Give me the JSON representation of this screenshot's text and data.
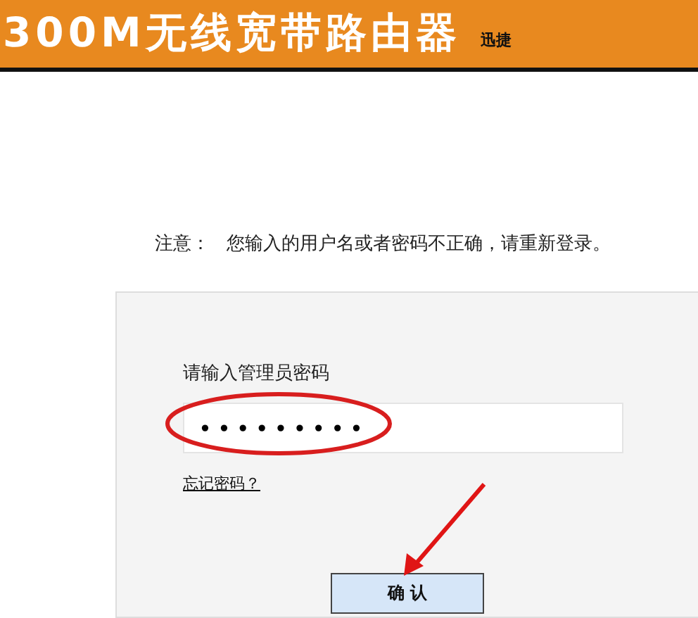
{
  "header": {
    "title": "300M无线宽带路由器",
    "brand": "迅捷"
  },
  "notice": {
    "label": "注意：",
    "message": "您输入的用户名或者密码不正确，请重新登录。"
  },
  "login": {
    "label": "请输入管理员密码",
    "password": {
      "value": "•••••••••"
    },
    "forgot_link": "忘记密码？",
    "confirm_button": "确 认"
  }
}
